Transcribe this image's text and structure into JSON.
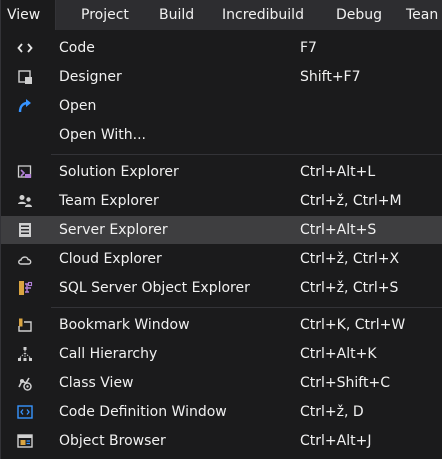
{
  "menubar": {
    "items": [
      {
        "label": "View",
        "active": true
      },
      {
        "label": "Project"
      },
      {
        "label": "Build"
      },
      {
        "label": "Incredibuild"
      },
      {
        "label": "Debug"
      },
      {
        "label": "Tean"
      }
    ]
  },
  "view_menu": {
    "items": [
      {
        "label": "Code",
        "shortcut": "F7",
        "icon": "code-icon"
      },
      {
        "label": "Designer",
        "shortcut": "Shift+F7",
        "icon": "designer-icon"
      },
      {
        "label": "Open",
        "shortcut": "",
        "icon": "open-arrow-icon"
      },
      {
        "label": "Open With...",
        "shortcut": "",
        "icon": ""
      },
      {
        "label": "Solution Explorer",
        "shortcut": "Ctrl+Alt+L",
        "icon": "solution-explorer-icon"
      },
      {
        "label": "Team Explorer",
        "shortcut": "Ctrl+ž, Ctrl+M",
        "icon": "team-explorer-icon"
      },
      {
        "label": "Server Explorer",
        "shortcut": "Ctrl+Alt+S",
        "icon": "server-explorer-icon",
        "highlighted": true
      },
      {
        "label": "Cloud Explorer",
        "shortcut": "Ctrl+ž, Ctrl+X",
        "icon": "cloud-icon"
      },
      {
        "label": "SQL Server Object Explorer",
        "shortcut": "Ctrl+ž, Ctrl+S",
        "icon": "sql-server-icon"
      },
      {
        "label": "Bookmark Window",
        "shortcut": "Ctrl+K, Ctrl+W",
        "icon": "bookmark-icon"
      },
      {
        "label": "Call Hierarchy",
        "shortcut": "Ctrl+Alt+K",
        "icon": "call-hierarchy-icon"
      },
      {
        "label": "Class View",
        "shortcut": "Ctrl+Shift+C",
        "icon": "class-view-icon"
      },
      {
        "label": "Code Definition Window",
        "shortcut": "Ctrl+ž, D",
        "icon": "code-definition-icon"
      },
      {
        "label": "Object Browser",
        "shortcut": "Ctrl+Alt+J",
        "icon": "object-browser-icon"
      }
    ]
  },
  "colors": {
    "menu_background": "#1b1b1c",
    "menubar_background": "#2d2d30",
    "highlight": "#3e3e40",
    "text": "#f1f1f1",
    "accent_blue": "#3794ff"
  }
}
